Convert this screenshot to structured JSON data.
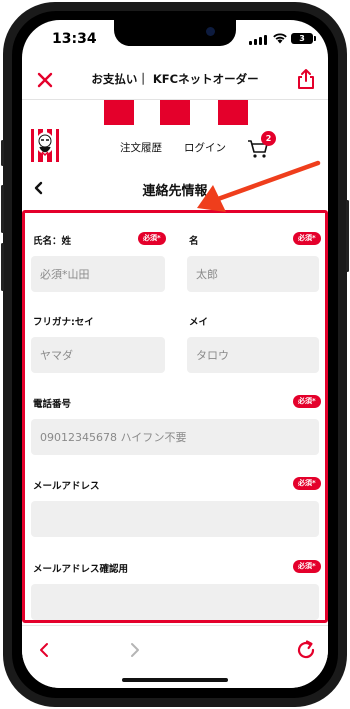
{
  "status_bar": {
    "time": "13:34",
    "battery": "3"
  },
  "header": {
    "title": "お支払い｜ KFCネットオーダー"
  },
  "nav": {
    "order_history": "注文履歴",
    "login": "ログイン",
    "cart_count": "2"
  },
  "page": {
    "title": "連絡先情報"
  },
  "form": {
    "required_badge": "必須*",
    "last_name": {
      "label": "氏名：姓",
      "placeholder": "必須*山田"
    },
    "first_name": {
      "label": "名",
      "placeholder": "太郎"
    },
    "last_kana": {
      "label": "フリガナ:セイ",
      "placeholder": "ヤマダ"
    },
    "first_kana": {
      "label": "メイ",
      "placeholder": "タロウ"
    },
    "phone": {
      "label": "電話番号",
      "placeholder": "09012345678 ハイフン不要"
    },
    "email": {
      "label": "メールアドレス",
      "placeholder": ""
    },
    "email_confirm": {
      "label": "メールアドレス確認用",
      "placeholder": ""
    }
  },
  "colors": {
    "brand_red": "#e4002b"
  }
}
